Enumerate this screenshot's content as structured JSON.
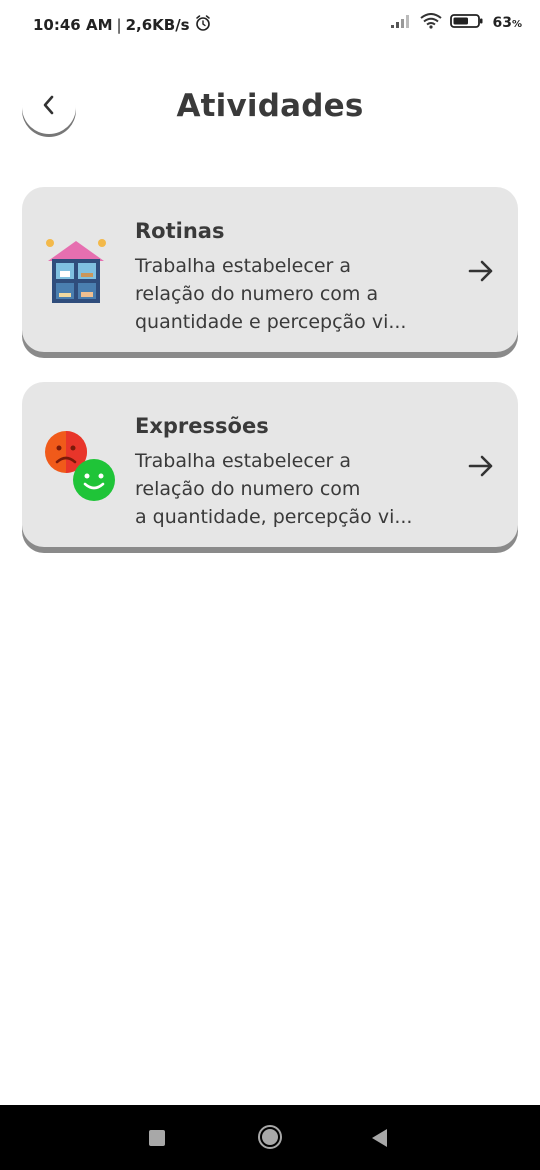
{
  "status_bar": {
    "time": "10:46 AM",
    "separator": "|",
    "data_speed": "2,6KB/s",
    "battery_percent": "63",
    "battery_suffix": "%",
    "battery_level": 0.63
  },
  "header": {
    "title": "Atividades"
  },
  "cards": [
    {
      "title": "Rotinas",
      "description_lines": [
        "Trabalha estabelecer a",
        "relação do numero com a",
        "quantidade e percepção vi..."
      ],
      "icon": "house-icon"
    },
    {
      "title": "Expressões",
      "description_lines": [
        "Trabalha estabelecer a",
        "relação do numero com",
        "a quantidade, percepção vi..."
      ],
      "icon": "emotion-faces-icon"
    }
  ],
  "colors": {
    "card_bg": "#e6e6e6",
    "card_shadow": "#8a8a8a",
    "text": "#3a3a3a",
    "sad_face": "#f05a1a",
    "happy_face": "#1fc438",
    "navbar": "#000000"
  }
}
